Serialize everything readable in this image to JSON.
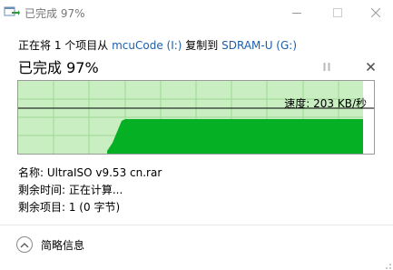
{
  "window": {
    "title": "已完成 97%"
  },
  "copy": {
    "prefix": "正在将 1 个项目从 ",
    "source": "mcuCode (I:)",
    "middle": " 复制到 ",
    "destination": "SDRAM-U (G:)"
  },
  "status": {
    "heading": "已完成 97%",
    "progress_percent": 97
  },
  "graph": {
    "speed_label": "速度: 203 KB/秒"
  },
  "details": {
    "name": "名称: UltraISO v9.53 cn.rar",
    "time_remaining": "剩余时间: 正在计算...",
    "items_remaining": "剩余项目: 1 (0 字节)"
  },
  "footer": {
    "less_details_label": "简略信息"
  },
  "colors": {
    "progress_fill": "#c8eec1",
    "progress_grid": "#9ed894",
    "speed_area": "#06b025",
    "speed_line": "#000000",
    "link": "#1c5fab"
  }
}
